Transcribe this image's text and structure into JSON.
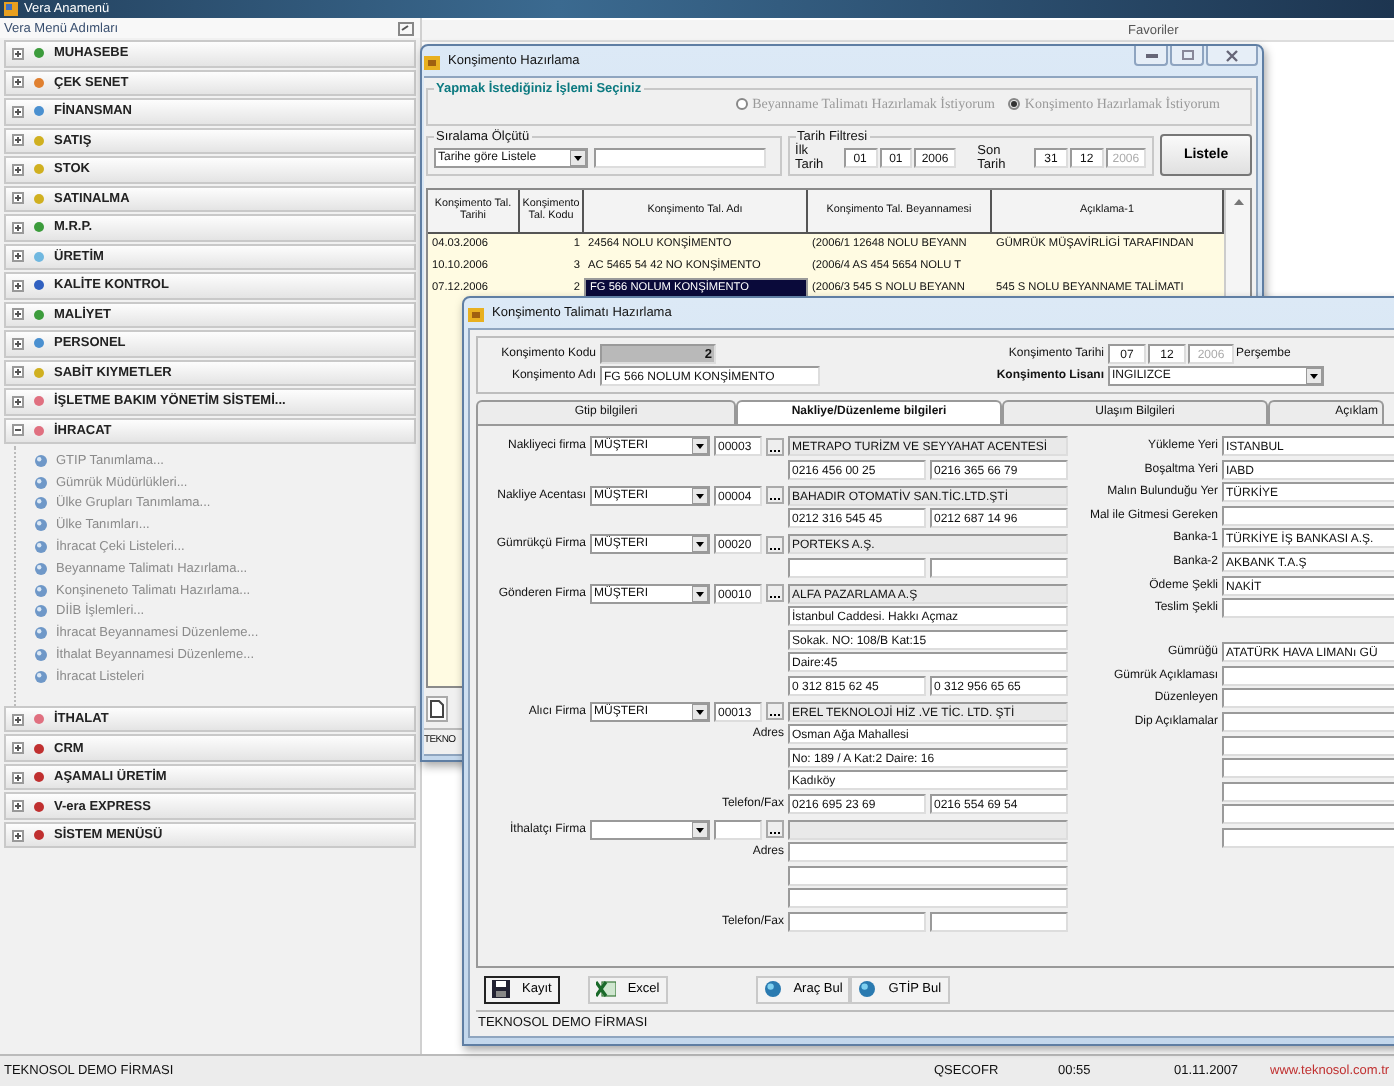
{
  "app_title": "Vera Anamenü",
  "sidebar": {
    "title": "Vera Menü Adımları",
    "items": [
      {
        "label": "MUHASEBE",
        "expanded": false,
        "color": "#3c9c3c"
      },
      {
        "label": "ÇEK SENET",
        "expanded": false,
        "color": "#e08030"
      },
      {
        "label": "FİNANSMAN",
        "expanded": false,
        "color": "#4a90d0"
      },
      {
        "label": "SATIŞ",
        "expanded": false,
        "color": "#d0b020"
      },
      {
        "label": "STOK",
        "expanded": false,
        "color": "#d0b020"
      },
      {
        "label": "SATINALMA",
        "expanded": false,
        "color": "#d0b020"
      },
      {
        "label": "M.R.P.",
        "expanded": false,
        "color": "#3c9c3c"
      },
      {
        "label": "ÜRETİM",
        "expanded": false,
        "color": "#70b8e0"
      },
      {
        "label": "KALİTE KONTROL",
        "expanded": false,
        "color": "#3060c0"
      },
      {
        "label": "MALİYET",
        "expanded": false,
        "color": "#3c9c3c"
      },
      {
        "label": "PERSONEL",
        "expanded": false,
        "color": "#4a90d0"
      },
      {
        "label": "SABİT KIYMETLER",
        "expanded": false,
        "color": "#d0b020"
      },
      {
        "label": "İŞLETME BAKIM YÖNETİM SİSTEMİ...",
        "expanded": false,
        "color": "#e07080"
      },
      {
        "label": "İHRACAT",
        "expanded": true,
        "color": "#e07080",
        "children": [
          {
            "label": "GTIP Tanımlama..."
          },
          {
            "label": "Gümrük Müdürlükleri..."
          },
          {
            "label": "Ülke Grupları Tanımlama..."
          },
          {
            "label": "Ülke Tanımları..."
          },
          {
            "label": "İhracat Çeki Listeleri..."
          },
          {
            "label": "Beyanname Talimatı Hazırlama..."
          },
          {
            "label": "Konşineneto Talimatı Hazırlama..."
          },
          {
            "label": "DİİB İşlemleri..."
          },
          {
            "label": "İhracat Beyannamesi Düzenleme..."
          },
          {
            "label": "İthalat Beyannamesi Düzenleme..."
          },
          {
            "label": "İhracat Listeleri"
          }
        ]
      },
      {
        "label": "İTHALAT",
        "expanded": false,
        "color": "#e07080"
      },
      {
        "label": "CRM",
        "expanded": false,
        "color": "#c03030"
      },
      {
        "label": "AŞAMALI ÜRETİM",
        "expanded": false,
        "color": "#c03030"
      },
      {
        "label": "V-era EXPRESS",
        "expanded": false,
        "color": "#c03030"
      },
      {
        "label": "SİSTEM MENÜSÜ",
        "expanded": false,
        "color": "#c03030"
      }
    ]
  },
  "favorites": {
    "title": "Favoriler"
  },
  "list_window": {
    "title": "Konşimento Hazırlama",
    "mode_group": {
      "title": "Yapmak İstediğiniz İşlemi Seçiniz",
      "options": [
        {
          "label": "Beyanname Talimatı Hazırlamak İstiyorum",
          "selected": false
        },
        {
          "label": "Konşimento Hazırlamak İstiyorum",
          "selected": true
        }
      ]
    },
    "sort": {
      "title": "Sıralama Ölçütü",
      "value": "Tarihe göre Listele"
    },
    "date_filter": {
      "title": "Tarih Filtresi",
      "start_label": "İlk Tarih",
      "start": [
        {
          "value": "01",
          "disabled": false
        },
        {
          "value": "01",
          "disabled": false
        },
        {
          "value": "2006",
          "disabled": false
        }
      ],
      "end_label": "Son Tarih",
      "end": [
        {
          "value": "31",
          "disabled": false
        },
        {
          "value": "12",
          "disabled": false
        },
        {
          "value": "2006",
          "disabled": true
        }
      ]
    },
    "list_button": "Listele",
    "table": {
      "columns": [
        "Konşimento Tal. Tarihi",
        "Konşimento Tal. Kodu",
        "Konşimento Tal. Adı",
        "Konşimento Tal. Beyannamesi",
        "Açıklama-1"
      ],
      "rows": [
        {
          "date": "04.03.2006",
          "code": "1",
          "name": "24564 NOLU KONŞİMENTO",
          "declaration": "(2006/1 12648 NOLU BEYANN",
          "note": "GÜMRÜK MÜŞAVİRLİGİ TARAFINDAN",
          "selected": false
        },
        {
          "date": "10.10.2006",
          "code": "3",
          "name": "AC 5465 54  42 NO KONŞİMENTO",
          "declaration": "(2006/4 AS 454 5654 NOLU T",
          "selected": false
        },
        {
          "date": "07.12.2006",
          "code": "2",
          "name": "FG 566 NOLUM KONŞİMENTO",
          "declaration": "(2006/3 545 S NOLU BEYANN",
          "note": "545 S NOLU BEYANNAME TALİMATI",
          "selected": true
        }
      ]
    },
    "status": "TEKNO"
  },
  "form_window": {
    "title": "Konşimento Talimatı Hazırlama",
    "code_label": "Konşimento Kodu",
    "code": "2",
    "name_label": "Konşimento Adı",
    "name": "FG 566 NOLUM KONŞİMENTO",
    "date_label": "Konşimento Tarihi",
    "date": [
      {
        "value": "07",
        "disabled": false
      },
      {
        "value": "12",
        "disabled": false
      },
      {
        "value": "2006",
        "disabled": true
      }
    ],
    "weekday": "Perşembe",
    "language_label": "Konşimento Lisanı",
    "language": "INGILIZCE",
    "tabs": [
      {
        "label": "Gtip bilgileri",
        "selected": false
      },
      {
        "label": "Nakliye/Düzenleme bilgileri",
        "selected": true
      },
      {
        "label": "Ulaşım Bilgileri",
        "selected": false
      },
      {
        "label": "Açıklam",
        "selected": false
      }
    ],
    "parties": [
      {
        "label": "Nakliyeci firma",
        "type": "MÜŞTERI",
        "code": "00003",
        "name": "METRAPO TURİZM  VE SEYYAHAT  ACENTESİ",
        "lines": [
          {
            "kind": "phone",
            "first": "0216 456 00 25",
            "second": "0216 365 66 79"
          }
        ]
      },
      {
        "label": "Nakliye Acentası",
        "type": "MÜŞTERI",
        "code": "00004",
        "name": "BAHADIR OTOMATİV SAN.TİC.LTD.ŞTİ",
        "lines": [
          {
            "kind": "phone",
            "first": "0212 316 545 45",
            "second": "0212 687 14 96"
          }
        ]
      },
      {
        "label": "Gümrükçü Firma",
        "type": "MÜŞTERI",
        "code": "00020",
        "name": "PORTEKS A.Ş.",
        "lines": [
          {
            "kind": "phone"
          }
        ]
      },
      {
        "label": "Gönderen Firma",
        "type": "MÜŞTERI",
        "code": "00010",
        "name": "ALFA PAZARLAMA A.Ş",
        "lines": [
          {
            "kind": "address",
            "value": "İstanbul Caddesi. Hakkı Açmaz"
          },
          {
            "kind": "address",
            "value": "Sokak.  NO: 108/B  Kat:15"
          },
          {
            "kind": "address",
            "value": "Daire:45"
          },
          {
            "kind": "phone",
            "first": "0 312 815 62 45",
            "second": "0 312 956 65 65"
          }
        ]
      },
      {
        "label": "Alıcı Firma",
        "type": "MÜŞTERI",
        "code": "00013",
        "name": "EREL TEKNOLOJİ HİZ .VE TİC. LTD. ŞTİ",
        "lines": [
          {
            "kind": "address",
            "label": "Adres",
            "value": "Osman Ağa Mahallesi"
          },
          {
            "kind": "address",
            "value": "No: 189 / A  Kat:2  Daire: 16"
          },
          {
            "kind": "address",
            "value": "Kadıköy"
          },
          {
            "kind": "phone",
            "label": "Telefon/Fax",
            "first": "0216 695 23 69",
            "second": "0216 554 69 54"
          }
        ]
      },
      {
        "label": "İthalatçı Firma",
        "lines": [
          {
            "kind": "address",
            "label": "Adres"
          },
          {
            "kind": "address"
          },
          {
            "kind": "address"
          },
          {
            "kind": "phone",
            "label": "Telefon/Fax"
          }
        ]
      }
    ],
    "details": [
      {
        "label": "Yükleme Yeri",
        "value": "ISTANBUL"
      },
      {
        "label": "Boşaltma Yeri",
        "value": "IABD"
      },
      {
        "label": "Malın Bulunduğu Yer",
        "value": "TÜRKİYE"
      },
      {
        "label": "Mal ile Gitmesi Gereken"
      },
      {
        "label": "Banka-1",
        "value": "TÜRKİYE İŞ BANKASI A.Ş."
      },
      {
        "label": "Banka-2",
        "value": "AKBANK T.A.Ş"
      },
      {
        "label": "Ödeme Şekli",
        "value": "NAKİT"
      },
      {
        "label": "Teslim Şekli"
      }
    ],
    "customs": [
      {
        "kind": "labeled",
        "label": "Gümrüğü",
        "value": "ATATÜRK HAVA LIMANı GÜ"
      },
      {
        "kind": "labeled",
        "label": "Gümrük Açıklaması"
      },
      {
        "kind": "labeled",
        "label": "Düzenleyen"
      },
      {
        "kind": "labeled",
        "label": "Dip Açıklamalar"
      },
      {
        "kind": "blank"
      },
      {
        "kind": "blank"
      },
      {
        "kind": "blank"
      },
      {
        "kind": "blank"
      },
      {
        "kind": "blank"
      }
    ],
    "buttons": [
      {
        "label": "Kayıt",
        "kind": "save"
      },
      {
        "label": "Excel",
        "kind": "excel"
      },
      {
        "label": "Araç Bul",
        "kind": "find"
      },
      {
        "label": "GTİP Bul",
        "kind": "find"
      }
    ],
    "status": "TEKNOSOL DEMO FİRMASI"
  },
  "status_bar": {
    "company": "TEKNOSOL DEMO FİRMASI",
    "user": "QSECOFR",
    "time": "00:55",
    "date": "01.11.2007",
    "website": "www.teknosol.com.tr"
  }
}
